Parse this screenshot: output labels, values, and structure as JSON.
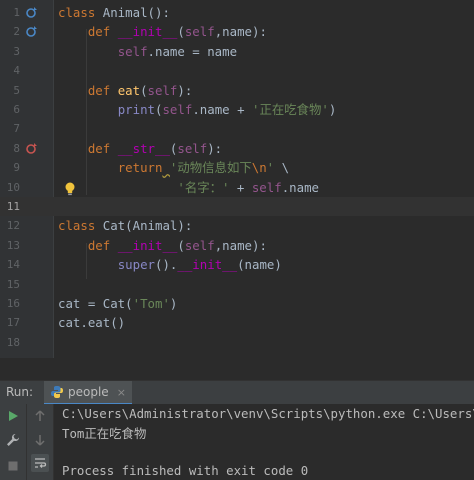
{
  "editor": {
    "line_numbers": [
      "1",
      "2",
      "3",
      "4",
      "5",
      "6",
      "7",
      "8",
      "9",
      "10",
      "11",
      "12",
      "13",
      "14",
      "15",
      "16",
      "17",
      "18"
    ],
    "current_line": "11",
    "lines": {
      "l1": [
        "class ",
        "Animal",
        "():"
      ],
      "l2": [
        "    ",
        "def ",
        "__init__",
        "(",
        "self",
        ",name):"
      ],
      "l3": [
        "        ",
        "self",
        ".name = name"
      ],
      "l5": [
        "    ",
        "def ",
        "eat",
        "(",
        "self",
        "):"
      ],
      "l6": [
        "        ",
        "print",
        "(",
        "self",
        ".name + ",
        "'正在吃食物'",
        ")"
      ],
      "l8": [
        "    ",
        "def ",
        "__str__",
        "(",
        "self",
        "):"
      ],
      "l9": [
        "        ",
        "return",
        " ",
        "'动物信息如下",
        "\\n",
        "'",
        " \\"
      ],
      "l10": [
        "                ",
        "'名字：'",
        " + ",
        "self",
        ".name"
      ],
      "l12": [
        "class ",
        "Cat",
        "(Animal):"
      ],
      "l13": [
        "    ",
        "def ",
        "__init__",
        "(",
        "self",
        ",name):"
      ],
      "l14": [
        "        ",
        "super",
        "().",
        "__init__",
        "(name)"
      ],
      "l16": [
        "cat = Cat(",
        "'Tom'",
        ")"
      ],
      "l17": [
        "cat.eat()"
      ]
    }
  },
  "run_panel": {
    "label": "Run:",
    "tab_label": "people",
    "tab_close": "×",
    "console_lines": [
      "C:\\Users\\Administrator\\venv\\Scripts\\python.exe C:\\Users\\Administrator\\people.py",
      "Tom正在吃食物",
      "",
      "Process finished with exit code 0"
    ]
  },
  "icons": {
    "run": "play-icon",
    "up": "arrow-up-icon",
    "down": "arrow-down-icon",
    "wrench": "wrench-icon",
    "stop": "stop-icon",
    "soft_wrap": "soft-wrap-icon",
    "bulb": "lightbulb-icon",
    "override": "override-icon"
  },
  "colors": {
    "keyword": "#cc7832",
    "self": "#94558d",
    "function": "#ffc66d",
    "string": "#6a8759",
    "magic": "#b200b2",
    "text": "#a9b7c6",
    "run_green": "#59a869"
  }
}
